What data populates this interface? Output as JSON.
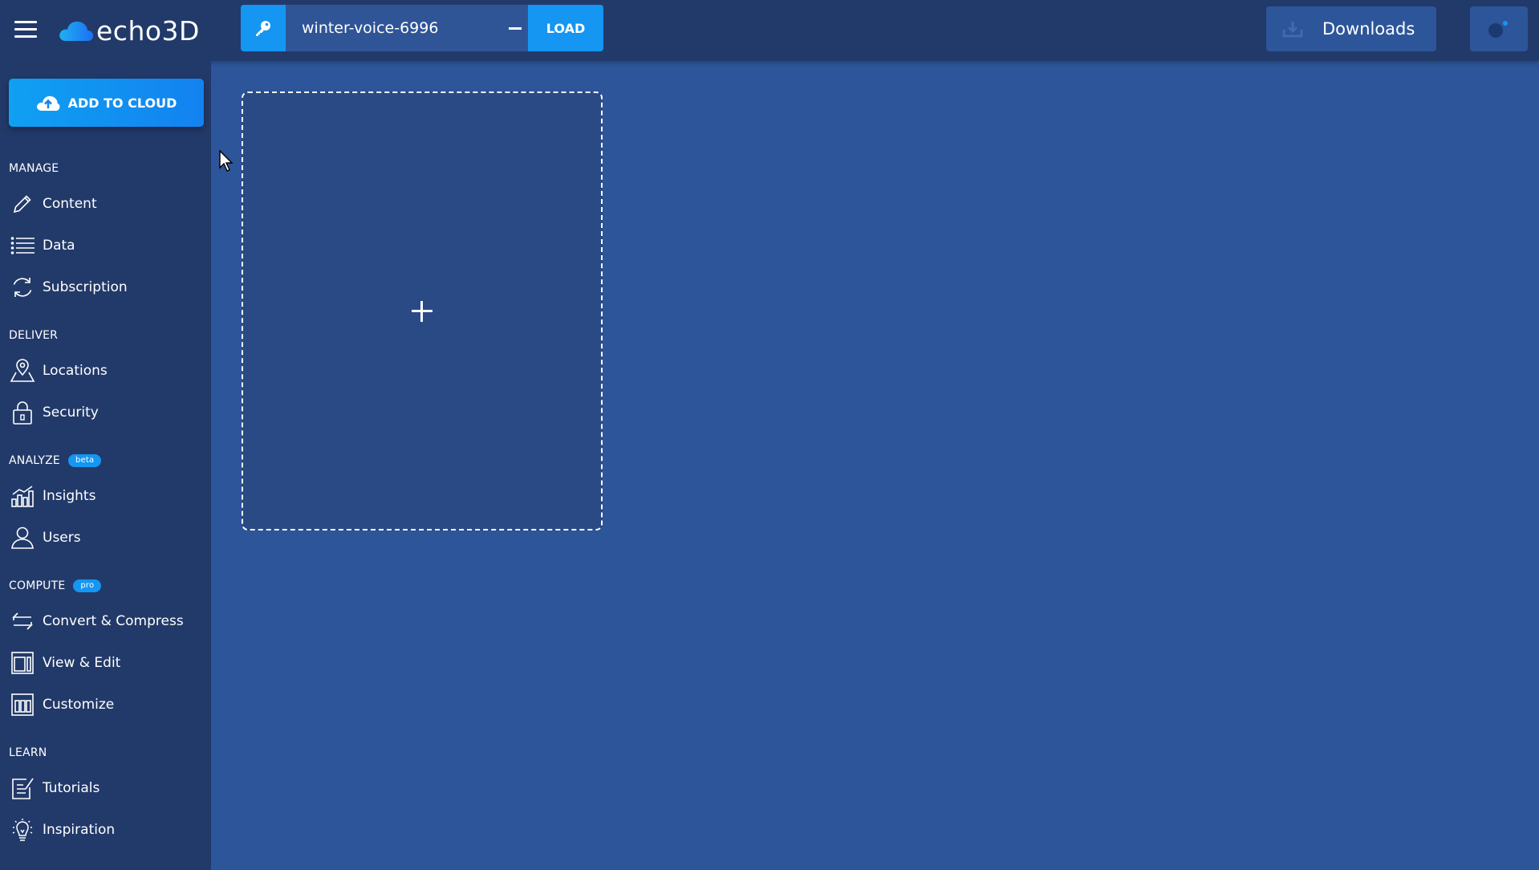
{
  "header": {
    "logo_text": "echo3D",
    "api_key": "winter-voice-6996",
    "load_label": "LOAD",
    "downloads_label": "Downloads"
  },
  "sidebar": {
    "add_to_cloud_label": "ADD TO CLOUD",
    "sections": {
      "manage": "MANAGE",
      "deliver": "DELIVER",
      "analyze": "ANALYZE",
      "analyze_badge": "beta",
      "compute": "COMPUTE",
      "compute_badge": "pro",
      "learn": "LEARN"
    },
    "items": {
      "content": "Content",
      "data": "Data",
      "subscription": "Subscription",
      "locations": "Locations",
      "security": "Security",
      "insights": "Insights",
      "users": "Users",
      "convert_compress": "Convert & Compress",
      "view_edit": "View & Edit",
      "customize": "Customize",
      "tutorials": "Tutorials",
      "inspiration": "Inspiration"
    }
  },
  "colors": {
    "background": "#2d5599",
    "bar": "#223a6a",
    "accent": "#1596f2"
  },
  "icons": [
    "menu-icon",
    "cloud-logo-icon",
    "key-icon",
    "download-icon",
    "avatar-icon",
    "cloud-upload-icon",
    "pencil-icon",
    "list-icon",
    "refresh-icon",
    "location-icon",
    "lock-icon",
    "bar-chart-icon",
    "user-icon",
    "convert-icon",
    "view-edit-icon",
    "customize-icon",
    "tutorials-icon",
    "lightbulb-icon",
    "plus-icon",
    "mouse-cursor-icon"
  ]
}
